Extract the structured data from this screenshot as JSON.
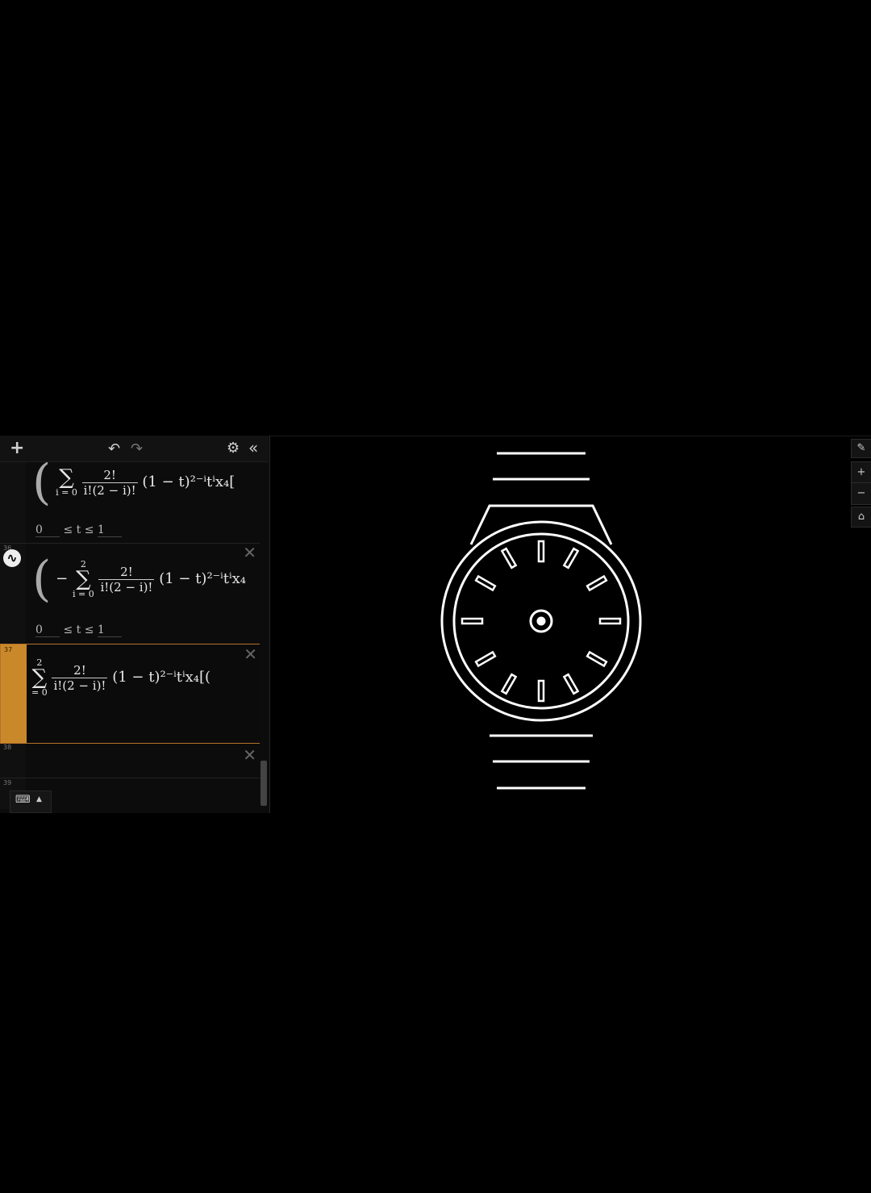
{
  "toolbar": {
    "add_icon": "plus-icon",
    "undo_icon": "undo-icon",
    "redo_icon": "redo-icon",
    "settings_icon": "gear-icon",
    "collapse_icon": "double-chevron-left-icon"
  },
  "expressions": [
    {
      "index": "",
      "sum_upper": "",
      "sum_lower": "i = 0",
      "numerator": "2!",
      "denominator": "i!(2 − i)!",
      "tail": "(1 − t)²⁻ⁱtⁱx₄[",
      "domain_low": "0",
      "domain_mid": "≤ t ≤",
      "domain_high": "1"
    },
    {
      "index": "36",
      "prefix": "−",
      "sum_upper": "2",
      "sum_lower": "i = 0",
      "numerator": "2!",
      "denominator": "i!(2 − i)!",
      "tail": "(1 − t)²⁻ⁱtⁱx₄",
      "domain_low": "0",
      "domain_mid": "≤ t ≤",
      "domain_high": "1"
    },
    {
      "index": "37",
      "sum_upper": "2",
      "sum_lower": "= 0",
      "numerator": "2!",
      "denominator": "i!(2 − i)!",
      "tail": "(1 − t)²⁻ⁱtⁱx₄[("
    },
    {
      "index": "38"
    },
    {
      "index": "39"
    }
  ],
  "keyboard": {
    "icon": "keyboard-icon",
    "arrow": "▲"
  },
  "graph_controls": {
    "wrench_icon": "wrench-icon",
    "zoom_in": "+",
    "zoom_out": "−",
    "home_icon": "home-icon"
  },
  "colors": {
    "accent": "#c9892a",
    "background": "#000000",
    "curve": "#ffffff"
  }
}
